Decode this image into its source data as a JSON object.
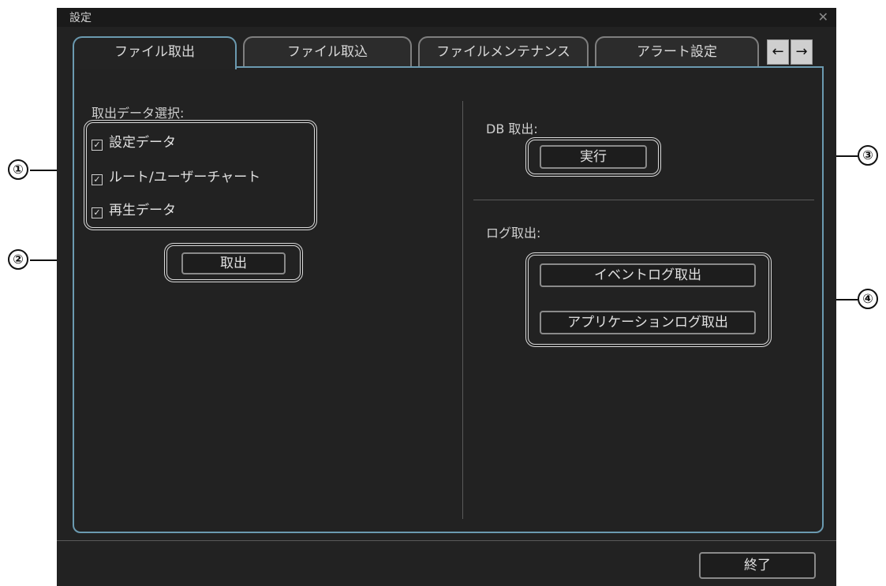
{
  "window": {
    "title": "設定"
  },
  "tabs": [
    {
      "label": "ファイル取出",
      "active": true
    },
    {
      "label": "ファイル取込",
      "active": false
    },
    {
      "label": "ファイルメンテナンス",
      "active": false
    },
    {
      "label": "アラート設定",
      "active": false
    }
  ],
  "tab_nav": {
    "prev": "←",
    "next": "→"
  },
  "export": {
    "section_label": "取出データ選択:",
    "options": [
      {
        "label": "設定データ",
        "checked": true
      },
      {
        "label": "ルート/ユーザーチャート",
        "checked": true
      },
      {
        "label": "再生データ",
        "checked": true
      }
    ],
    "button": "取出"
  },
  "db": {
    "section_label": "DB 取出:",
    "button": "実行"
  },
  "log": {
    "section_label": "ログ取出:",
    "event_button": "イベントログ取出",
    "app_button": "アプリケーションログ取出"
  },
  "footer": {
    "close_button": "終了"
  },
  "callouts": [
    "①",
    "②",
    "③",
    "④"
  ],
  "colors": {
    "background": "#222222",
    "accent": "#6b9ab0",
    "text": "#d8d8d8"
  }
}
